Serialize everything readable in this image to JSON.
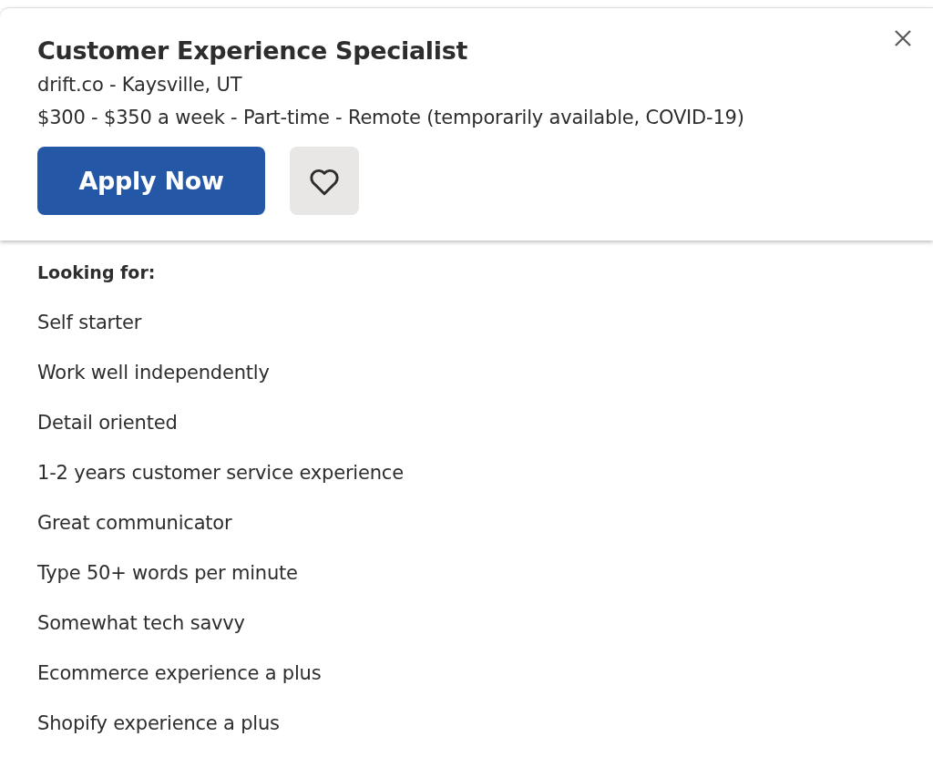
{
  "header": {
    "title": "Customer Experience Specialist",
    "company": "drift.co - Kaysville, UT",
    "details": "$300 - $350 a week - Part-time - Remote (temporarily available, COVID-19)",
    "apply_button": "Apply Now"
  },
  "description": {
    "heading": "Looking for:",
    "items": [
      "Self starter",
      "Work well independently",
      "Detail oriented",
      "1-2 years customer service experience",
      "Great communicator",
      "Type 50+ words per minute",
      "Somewhat tech savvy",
      "Ecommerce experience a plus",
      "Shopify experience a plus"
    ]
  }
}
